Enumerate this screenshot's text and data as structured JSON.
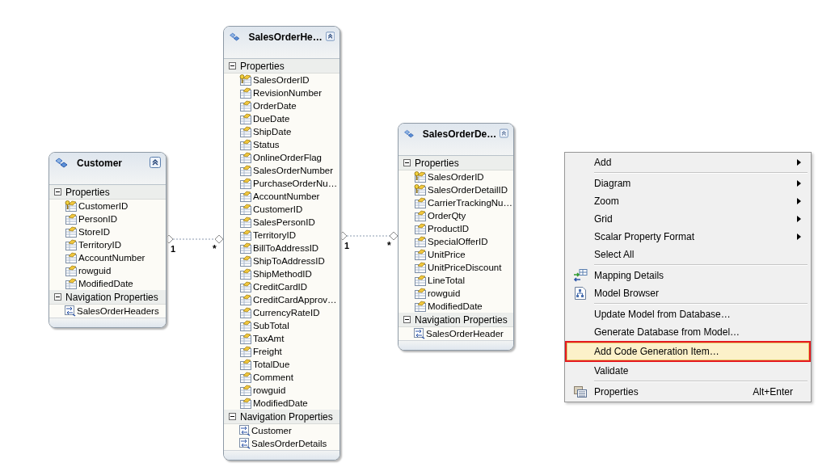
{
  "entities": [
    {
      "name": "Customer",
      "sections": [
        {
          "title": "Properties",
          "expanded": true,
          "items": [
            {
              "name": "CustomerID",
              "kind": "key"
            },
            {
              "name": "PersonID",
              "kind": "property"
            },
            {
              "name": "StoreID",
              "kind": "property"
            },
            {
              "name": "TerritoryID",
              "kind": "property"
            },
            {
              "name": "AccountNumber",
              "kind": "property"
            },
            {
              "name": "rowguid",
              "kind": "property"
            },
            {
              "name": "ModifiedDate",
              "kind": "property"
            }
          ]
        },
        {
          "title": "Navigation Properties",
          "expanded": true,
          "items": [
            {
              "name": "SalesOrderHeaders",
              "kind": "navigation"
            }
          ]
        }
      ]
    },
    {
      "name": "SalesOrderHe…",
      "sections": [
        {
          "title": "Properties",
          "expanded": true,
          "items": [
            {
              "name": "SalesOrderID",
              "kind": "key"
            },
            {
              "name": "RevisionNumber",
              "kind": "property"
            },
            {
              "name": "OrderDate",
              "kind": "property"
            },
            {
              "name": "DueDate",
              "kind": "property"
            },
            {
              "name": "ShipDate",
              "kind": "property"
            },
            {
              "name": "Status",
              "kind": "property"
            },
            {
              "name": "OnlineOrderFlag",
              "kind": "property"
            },
            {
              "name": "SalesOrderNumber",
              "kind": "property"
            },
            {
              "name": "PurchaseOrderNu…",
              "kind": "property"
            },
            {
              "name": "AccountNumber",
              "kind": "property"
            },
            {
              "name": "CustomerID",
              "kind": "property"
            },
            {
              "name": "SalesPersonID",
              "kind": "property"
            },
            {
              "name": "TerritoryID",
              "kind": "property"
            },
            {
              "name": "BillToAddressID",
              "kind": "property"
            },
            {
              "name": "ShipToAddressID",
              "kind": "property"
            },
            {
              "name": "ShipMethodID",
              "kind": "property"
            },
            {
              "name": "CreditCardID",
              "kind": "property"
            },
            {
              "name": "CreditCardApprov…",
              "kind": "property"
            },
            {
              "name": "CurrencyRateID",
              "kind": "property"
            },
            {
              "name": "SubTotal",
              "kind": "property"
            },
            {
              "name": "TaxAmt",
              "kind": "property"
            },
            {
              "name": "Freight",
              "kind": "property"
            },
            {
              "name": "TotalDue",
              "kind": "property"
            },
            {
              "name": "Comment",
              "kind": "property"
            },
            {
              "name": "rowguid",
              "kind": "property"
            },
            {
              "name": "ModifiedDate",
              "kind": "property"
            }
          ]
        },
        {
          "title": "Navigation Properties",
          "expanded": true,
          "items": [
            {
              "name": "Customer",
              "kind": "navigation"
            },
            {
              "name": "SalesOrderDetails",
              "kind": "navigation"
            }
          ]
        }
      ]
    },
    {
      "name": "SalesOrderDe…",
      "sections": [
        {
          "title": "Properties",
          "expanded": true,
          "items": [
            {
              "name": "SalesOrderID",
              "kind": "key"
            },
            {
              "name": "SalesOrderDetailID",
              "kind": "key"
            },
            {
              "name": "CarrierTrackingNu…",
              "kind": "property"
            },
            {
              "name": "OrderQty",
              "kind": "property"
            },
            {
              "name": "ProductID",
              "kind": "property"
            },
            {
              "name": "SpecialOfferID",
              "kind": "property"
            },
            {
              "name": "UnitPrice",
              "kind": "property"
            },
            {
              "name": "UnitPriceDiscount",
              "kind": "property"
            },
            {
              "name": "LineTotal",
              "kind": "property"
            },
            {
              "name": "rowguid",
              "kind": "property"
            },
            {
              "name": "ModifiedDate",
              "kind": "property"
            }
          ]
        },
        {
          "title": "Navigation Properties",
          "expanded": true,
          "items": [
            {
              "name": "SalesOrderHeader",
              "kind": "navigation"
            }
          ]
        }
      ]
    }
  ],
  "associations": [
    {
      "from_end": "1",
      "to_end": "*"
    },
    {
      "from_end": "1",
      "to_end": "*"
    }
  ],
  "context_menu": {
    "groups": [
      [
        {
          "label": "Add",
          "kind": "command",
          "submenu": true,
          "selected": false
        }
      ],
      [
        {
          "label": "Diagram",
          "kind": "command",
          "submenu": true,
          "selected": false
        },
        {
          "label": "Zoom",
          "kind": "command",
          "submenu": true,
          "selected": false
        },
        {
          "label": "Grid",
          "kind": "command",
          "submenu": true,
          "selected": false
        },
        {
          "label": "Scalar Property Format",
          "kind": "command",
          "submenu": true,
          "selected": false
        },
        {
          "label": "Select All",
          "kind": "command",
          "submenu": false,
          "selected": false
        }
      ],
      [
        {
          "label": "Mapping Details",
          "kind": "mapping",
          "submenu": false,
          "selected": false
        },
        {
          "label": "Model Browser",
          "kind": "browser",
          "submenu": false,
          "selected": false
        }
      ],
      [
        {
          "label": "Update Model from Database…",
          "kind": "command",
          "submenu": false,
          "selected": false
        },
        {
          "label": "Generate Database from Model…",
          "kind": "command",
          "submenu": false,
          "selected": false
        },
        {
          "label": "Add Code Generation Item…",
          "kind": "command",
          "submenu": false,
          "selected": true
        },
        {
          "label": "Validate",
          "kind": "command",
          "submenu": false,
          "selected": false
        }
      ],
      [
        {
          "label": "Properties",
          "kind": "properties",
          "submenu": false,
          "selected": false,
          "shortcut": "Alt+Enter"
        }
      ]
    ]
  }
}
